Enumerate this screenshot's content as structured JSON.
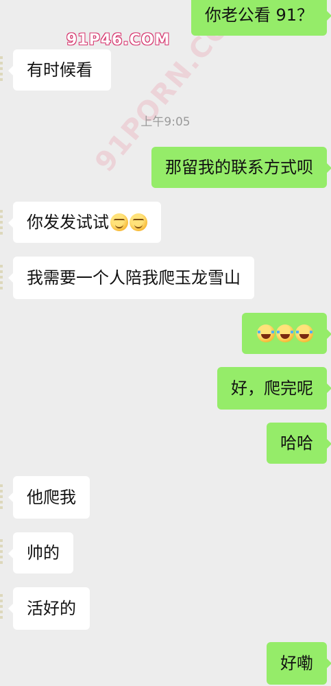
{
  "watermark": {
    "top": "91P46.COM",
    "diagonal": "91PORN.COM"
  },
  "timestamp": "上午9:05",
  "messages": [
    {
      "id": 0,
      "side": "out",
      "text": "你老公看 91？"
    },
    {
      "id": 1,
      "side": "in",
      "text": "有时候看"
    },
    {
      "id": 2,
      "side": "out",
      "text": "那留我的联系方式呗"
    },
    {
      "id": 3,
      "side": "in",
      "text": "你发发试试",
      "emoji": [
        "thinking-face-emoji",
        "thinking-face-emoji"
      ]
    },
    {
      "id": 4,
      "side": "in",
      "text": "我需要一个人陪我爬玉龙雪山"
    },
    {
      "id": 5,
      "side": "out",
      "text": "",
      "emoji": [
        "laughing-crying-emoji",
        "laughing-crying-emoji",
        "laughing-crying-emoji"
      ]
    },
    {
      "id": 6,
      "side": "out",
      "text": "好，爬完呢"
    },
    {
      "id": 7,
      "side": "out",
      "text": "哈哈"
    },
    {
      "id": 8,
      "side": "in",
      "text": "他爬我"
    },
    {
      "id": 9,
      "side": "in",
      "text": "帅的"
    },
    {
      "id": 10,
      "side": "in",
      "text": "活好的"
    },
    {
      "id": 11,
      "side": "out",
      "text": "好嘞"
    }
  ],
  "colors": {
    "background": "#ededed",
    "incoming_bubble": "#ffffff",
    "outgoing_bubble": "#95ec69",
    "timestamp_text": "#9a9a9a"
  }
}
